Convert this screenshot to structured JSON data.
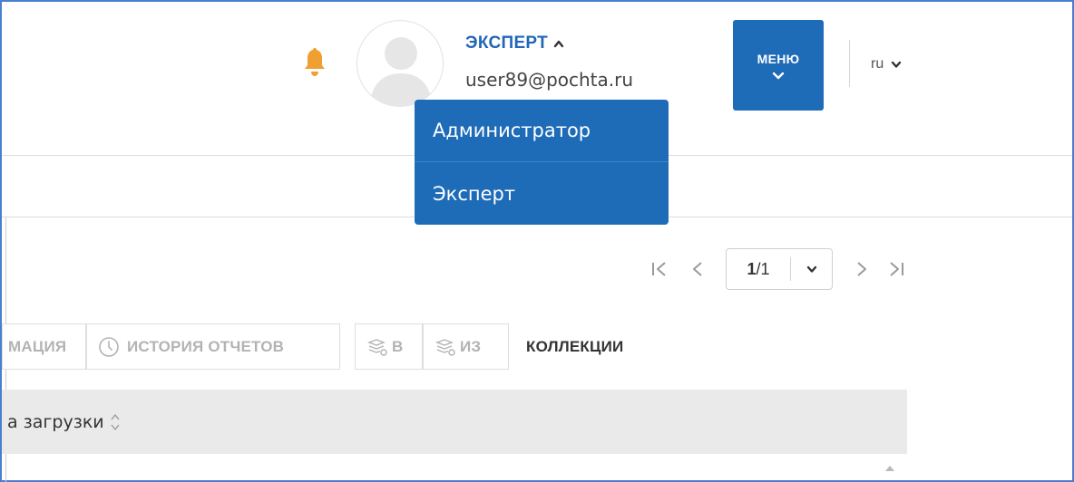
{
  "header": {
    "bell_icon": "bell-icon",
    "accent_color": "#f0a030",
    "brand_color": "#1e6bb8",
    "avatar_icon": "user-silhouette-icon",
    "user": {
      "role": "ЭКСПЕРТ",
      "email": "user89@pochta.ru"
    },
    "menu_button_label": "МЕНЮ",
    "language": "ru"
  },
  "role_dropdown": {
    "items": [
      {
        "label": "Администратор"
      },
      {
        "label": "Эксперт"
      }
    ]
  },
  "pager": {
    "current": "1",
    "total": "/1"
  },
  "tabs": [
    {
      "label": "МАЦИЯ",
      "icon": ""
    },
    {
      "label": "ИСТОРИЯ ОТЧЕТОВ",
      "icon": "clock-icon"
    },
    {
      "label": "В",
      "icon": "collection-icon"
    },
    {
      "label": "ИЗ",
      "icon": "collection-icon"
    },
    {
      "label": "КОЛЛЕКЦИИ",
      "icon": "",
      "active": true
    }
  ],
  "table": {
    "columns": [
      {
        "label": "а загрузки"
      }
    ]
  }
}
